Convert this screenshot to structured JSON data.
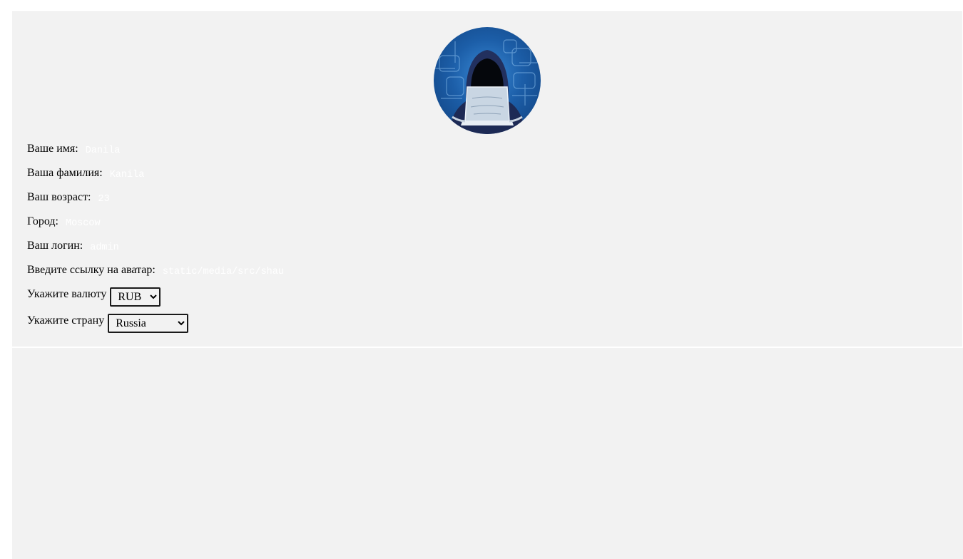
{
  "profile": {
    "avatar_icon": "hooded-hacker-avatar",
    "fields": {
      "first_name": {
        "label": "Ваше имя:",
        "value": "Danila"
      },
      "last_name": {
        "label": "Ваша фамилия:",
        "value": "Kanila"
      },
      "age": {
        "label": "Ваш возраст:",
        "value": "23"
      },
      "city": {
        "label": "Город:",
        "value": "Moscow"
      },
      "login": {
        "label": "Ваш логин:",
        "value": "admin"
      },
      "avatar_link": {
        "label": "Введите ссылку на аватар:",
        "value": "static/media/src/shau"
      }
    },
    "currency": {
      "label": "Укажите валюту",
      "selected": "RUB"
    },
    "country": {
      "label": "Укажите страну",
      "selected": "Russia"
    }
  },
  "colors": {
    "panel_background": "#f2f2f2",
    "input_text": "#ffffff",
    "avatar_blue": "#1c5ea8"
  }
}
